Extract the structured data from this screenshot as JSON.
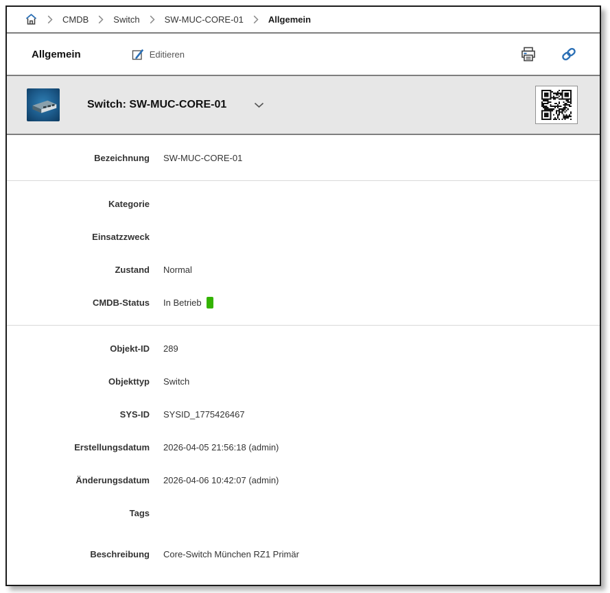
{
  "colors": {
    "accent": "#2a6fb5",
    "status_green": "#33b301",
    "icon_gray": "#444444"
  },
  "breadcrumb": {
    "home_icon": "home-icon",
    "items": [
      {
        "label": "CMDB",
        "active": false
      },
      {
        "label": "Switch",
        "active": false
      },
      {
        "label": "SW-MUC-CORE-01",
        "active": false
      },
      {
        "label": "Allgemein",
        "active": true
      }
    ]
  },
  "toolbar": {
    "title": "Allgemein",
    "edit_label": "Editieren",
    "icons": [
      "edit-icon",
      "print-icon",
      "link-icon"
    ]
  },
  "object_header": {
    "title": "Switch: SW-MUC-CORE-01",
    "thumbnail": "switch-image",
    "qr": "qr-code"
  },
  "sections": [
    {
      "rows": [
        {
          "label": "Bezeichnung",
          "value": "SW-MUC-CORE-01"
        }
      ]
    },
    {
      "rows": [
        {
          "label": "Kategorie",
          "value": ""
        },
        {
          "label": "Einsatzzweck",
          "value": ""
        },
        {
          "label": "Zustand",
          "value": "Normal"
        },
        {
          "label": "CMDB-Status",
          "value": "In Betrieb",
          "badge_color": "#33b301"
        }
      ]
    },
    {
      "rows": [
        {
          "label": "Objekt-ID",
          "value": "289"
        },
        {
          "label": "Objekttyp",
          "value": "Switch"
        },
        {
          "label": "SYS-ID",
          "value": "SYSID_1775426467"
        },
        {
          "label": "Erstellungsdatum",
          "value": "2026-04-05 21:56:18 (admin)"
        },
        {
          "label": "Änderungsdatum",
          "value": "2026-04-06 10:42:07 (admin)"
        },
        {
          "label": "Tags",
          "value": ""
        },
        {
          "label": "Beschreibung",
          "value": "Core-Switch München RZ1 Primär",
          "tall": true
        }
      ]
    }
  ]
}
